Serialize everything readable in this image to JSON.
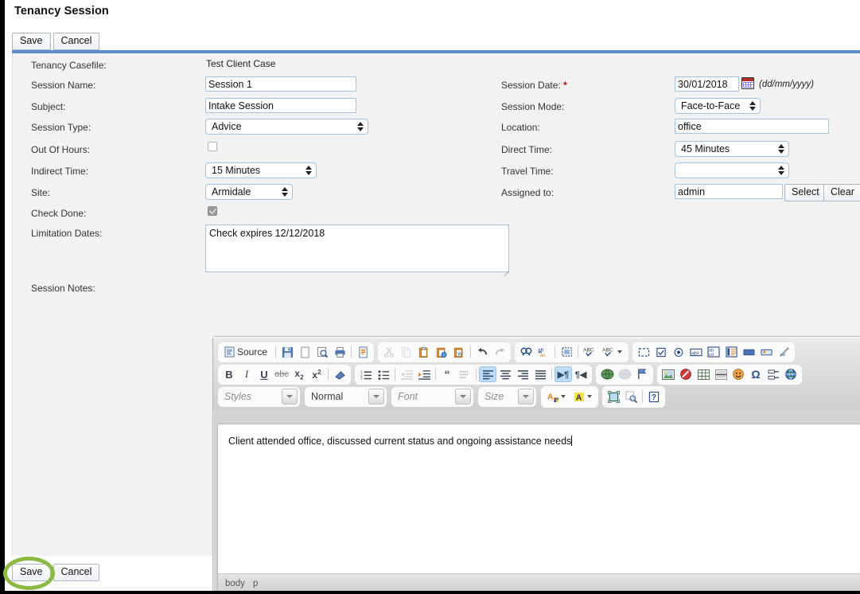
{
  "header": {
    "title": "Tenancy Session",
    "save_label": "Save",
    "cancel_label": "Cancel"
  },
  "footer": {
    "save_label": "Save",
    "cancel_label": "Cancel"
  },
  "colors": {
    "accent_bar": "#5b8fc9",
    "highlight_ring": "#8cb843",
    "required_marker": "#d00000",
    "form_background": "#f2f2f2"
  },
  "form": {
    "left": {
      "casefile_label": "Tenancy Casefile:",
      "casefile_value": "Test Client Case",
      "session_name_label": "Session Name:",
      "session_name_value": "Session 1",
      "subject_label": "Subject:",
      "subject_value": "Intake Session",
      "session_type_label": "Session Type:",
      "session_type_value": "Advice",
      "session_type_options": [
        "Advice"
      ],
      "out_of_hours_label": "Out Of Hours:",
      "out_of_hours_checked": false,
      "indirect_time_label": "Indirect Time:",
      "indirect_time_value": "15 Minutes",
      "indirect_time_options": [
        "15 Minutes"
      ],
      "site_label": "Site:",
      "site_value": "Armidale",
      "site_options": [
        "Armidale"
      ],
      "check_done_label": "Check Done:",
      "check_done_checked": true,
      "limitation_dates_label": "Limitation Dates:",
      "limitation_dates_value": "Check expires 12/12/2018",
      "session_notes_label": "Session Notes:"
    },
    "right": {
      "session_date_label": "Session Date:",
      "session_date_required": "*",
      "session_date_value": "30/01/2018",
      "session_date_hint": "(dd/mm/yyyy)",
      "session_mode_label": "Session Mode:",
      "session_mode_value": "Face-to-Face",
      "session_mode_options": [
        "Face-to-Face"
      ],
      "location_label": "Location:",
      "location_value": "office",
      "direct_time_label": "Direct Time:",
      "direct_time_value": "45 Minutes",
      "direct_time_options": [
        "45 Minutes"
      ],
      "travel_time_label": "Travel Time:",
      "travel_time_value": "",
      "travel_time_options": [
        ""
      ],
      "assigned_to_label": "Assigned to:",
      "assigned_to_value": "admin",
      "assigned_select_label": "Select",
      "assigned_clear_label": "Clear"
    }
  },
  "editor": {
    "source_label": "Source",
    "content_text": "Client attended office, discussed current status and ongoing assistance needs",
    "status_path": [
      "body",
      "p"
    ],
    "combos": {
      "styles": "Styles",
      "format": "Normal",
      "font": "Font",
      "size": "Size"
    },
    "toolbar_row1": [
      {
        "group": [
          "source-button",
          "save-icon",
          "new-page-icon",
          "preview-icon",
          "print-icon",
          "templates-icon"
        ]
      },
      {
        "group": [
          "cut-icon",
          "copy-icon",
          "paste-icon",
          "paste-text-icon",
          "paste-word-icon",
          "undo-icon",
          "redo-icon"
        ]
      },
      {
        "group": [
          "find-icon",
          "replace-icon",
          "select-all-icon",
          "spellcheck-icon",
          "spellcheck-menu-icon"
        ]
      },
      {
        "group": [
          "form-icon",
          "checkbox-icon",
          "radio-icon",
          "textfield-icon",
          "textarea-icon",
          "select-field-icon",
          "button-icon",
          "image-button-icon",
          "hidden-field-icon"
        ]
      }
    ],
    "toolbar_row2": [
      {
        "group": [
          "bold-icon",
          "italic-icon",
          "underline-icon",
          "strike-icon",
          "subscript-icon",
          "superscript-icon",
          "remove-format-icon"
        ]
      },
      {
        "group": [
          "numbered-list-icon",
          "bulleted-list-icon",
          "outdent-icon",
          "indent-icon",
          "blockquote-icon",
          "create-div-icon",
          "align-left-icon",
          "align-center-icon",
          "align-right-icon",
          "align-justify-icon",
          "ltr-icon",
          "rtl-icon"
        ]
      },
      {
        "group": [
          "link-icon",
          "unlink-icon",
          "anchor-icon"
        ]
      },
      {
        "group": [
          "image-icon",
          "flash-icon",
          "table-icon",
          "horizontal-rule-icon",
          "smiley-icon",
          "special-char-icon",
          "page-break-icon",
          "iframe-icon"
        ]
      }
    ],
    "toolbar_row3": [
      {
        "group": [
          "styles-combo",
          "format-combo",
          "font-combo",
          "size-combo"
        ]
      },
      {
        "group": [
          "text-color-icon",
          "background-color-icon"
        ]
      },
      {
        "group": [
          "maximize-icon",
          "show-blocks-icon",
          "about-icon"
        ]
      }
    ]
  }
}
